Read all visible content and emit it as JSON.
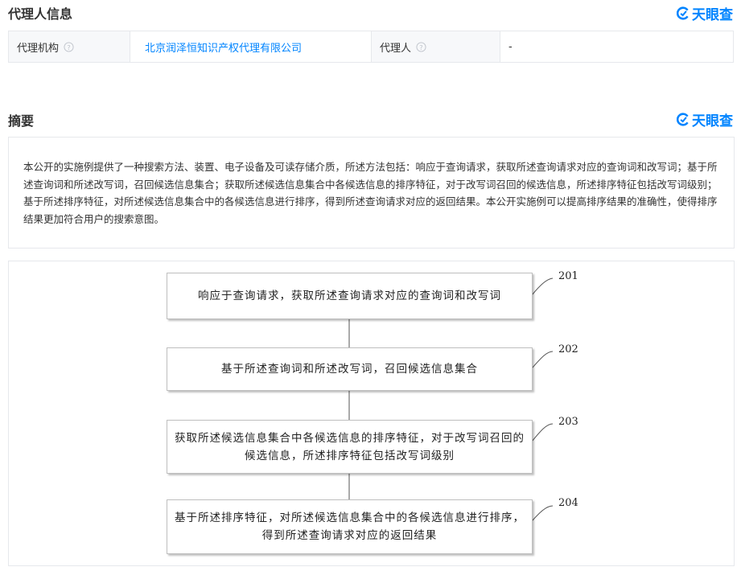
{
  "agent_section": {
    "title": "代理人信息",
    "brand": "天眼查",
    "agency_label": "代理机构",
    "agency_value": "北京润泽恒知识产权代理有限公司",
    "agent_label": "代理人",
    "agent_value": "-"
  },
  "abstract_section": {
    "title": "摘要",
    "brand": "天眼查",
    "text": "本公开的实施例提供了一种搜索方法、装置、电子设备及可读存储介质，所述方法包括：响应于查询请求，获取所述查询请求对应的查询词和改写词；基于所述查询词和所述改写词，召回候选信息集合；获取所述候选信息集合中各候选信息的排序特征，对于改写词召回的候选信息，所述排序特征包括改写词级别；基于所述排序特征，对所述候选信息集合中的各候选信息进行排序，得到所述查询请求对应的返回结果。本公开实施例可以提高排序结果的准确性，使得排序结果更加符合用户的搜索意图。"
  },
  "flowchart": {
    "steps": [
      {
        "id": "201",
        "text": "响应于查询请求，获取所述查询请求对应的查询词和改写词"
      },
      {
        "id": "202",
        "text": "基于所述查询词和所述改写词，召回候选信息集合"
      },
      {
        "id": "203",
        "text": "获取所述候选信息集合中各候选信息的排序特征，对于改写词召回的候选信息，所述排序特征包括改写词级别"
      },
      {
        "id": "204",
        "text": "基于所述排序特征，对所述候选信息集合中的各候选信息进行排序，得到所述查询请求对应的返回结果"
      }
    ]
  },
  "colors": {
    "link": "#0084ff",
    "brand": "#0084ff",
    "border": "#e6e8ec",
    "label_bg": "#f7f8fa"
  }
}
